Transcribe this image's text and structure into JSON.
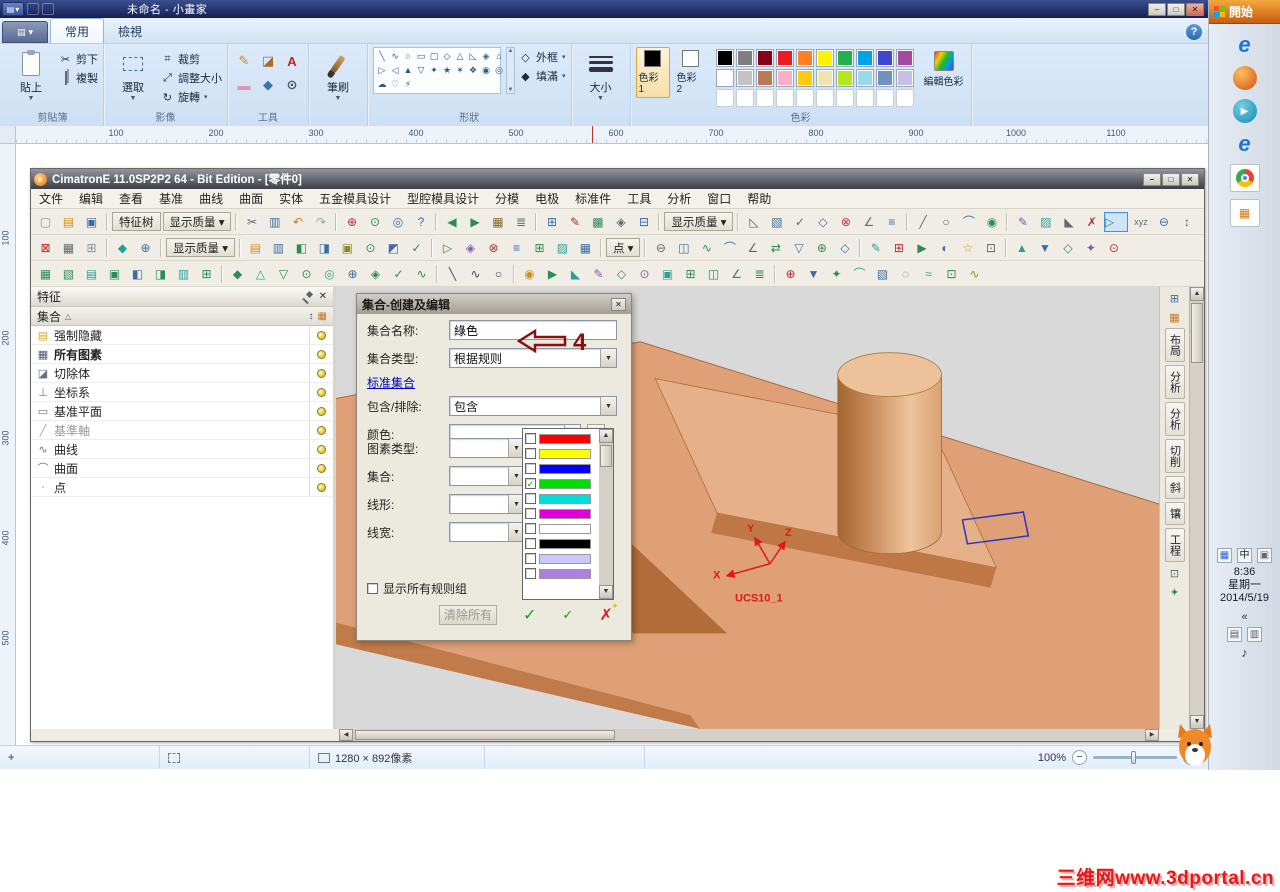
{
  "paint": {
    "title": "未命名 - 小畫家",
    "window_controls": {
      "minimize": "–",
      "maximize": "□",
      "close": "✕"
    },
    "tabs": [
      {
        "label": "常用",
        "active": true
      },
      {
        "label": "檢視",
        "active": false
      }
    ],
    "help_glyph": "?",
    "clipboard": {
      "label": "剪貼簿",
      "paste": "貼上",
      "cut": "剪下",
      "copy": "複製"
    },
    "image": {
      "label": "影像",
      "select": "選取",
      "crop": "裁剪",
      "resize": "調整大小",
      "rotate": "旋轉"
    },
    "tools": {
      "label": "工具",
      "items": [
        {
          "g": "✎",
          "c": "#c89018"
        },
        {
          "g": "◪",
          "c": "#b06828"
        },
        {
          "g": "A",
          "c": "#cc2020"
        },
        {
          "g": "▬",
          "c": "#e890b0"
        },
        {
          "g": "◆",
          "c": "#3878a8"
        },
        {
          "g": "⊙",
          "c": "#485868"
        }
      ]
    },
    "brushes": {
      "label": "筆刷"
    },
    "shapes": {
      "label": "形狀",
      "outline": "外框",
      "fill": "填滿",
      "glyphs": [
        "╲",
        "∿",
        "○",
        "▭",
        "▢",
        "◇",
        "△",
        "◺",
        "◈",
        "⌂",
        "▷",
        "◁",
        "▲",
        "▽",
        "✦",
        "★",
        "✶",
        "❖",
        "◉",
        "◎",
        "☁",
        "♡",
        "⚡"
      ]
    },
    "size": {
      "label": "大小"
    },
    "colors": {
      "label": "色彩",
      "color1_label": "色彩 1",
      "color2_label": "色彩 2",
      "edit_label": "編輯色彩",
      "color1": "#000000",
      "color2": "#ffffff",
      "row1": [
        "#000000",
        "#7f7f7f",
        "#880015",
        "#ed1c24",
        "#ff7f27",
        "#fff200",
        "#22b14c",
        "#00a2e8",
        "#3f48cc",
        "#a349a4"
      ],
      "row2": [
        "#ffffff",
        "#c3c3c3",
        "#b97a57",
        "#ffaec9",
        "#ffc90e",
        "#efe4b0",
        "#b5e61d",
        "#99d9ea",
        "#7092be",
        "#c8bfe7"
      ],
      "row3_count": 10
    },
    "ruler_h": [
      "100",
      "200",
      "300",
      "400",
      "500",
      "600",
      "700",
      "800",
      "900",
      "1000",
      "1100"
    ],
    "ruler_v": [
      "100",
      "200",
      "300",
      "400",
      "500"
    ],
    "status": {
      "size_text": "1280 × 892像素",
      "zoom": "100%"
    }
  },
  "cimatron": {
    "title": "CimatronE 11.0SP2P2 64 - Bit Edition - [零件0]",
    "window_controls": {
      "minimize": "–",
      "maximize": "□",
      "close": "✕"
    },
    "menu": [
      "文件",
      "编辑",
      "查看",
      "基准",
      "曲线",
      "曲面",
      "实体",
      "五金模具设计",
      "型腔模具设计",
      "分模",
      "电极",
      "标准件",
      "工具",
      "分析",
      "窗口",
      "帮助"
    ],
    "toolbar1": [
      {
        "g": "▢",
        "c": "#8890a0"
      },
      {
        "g": "▤",
        "c": "#d09018"
      },
      {
        "g": "▣",
        "c": "#3a6ea5"
      },
      {
        "sep": 1
      },
      {
        "t": "特征树"
      },
      {
        "t": "显示质量 ▾"
      },
      {
        "sep": 1
      },
      {
        "g": "✂",
        "c": "#606870"
      },
      {
        "g": "▥",
        "c": "#3a6ea5"
      },
      {
        "g": "↶",
        "c": "#d07818"
      },
      {
        "g": "↷",
        "c": "#98a0a8"
      },
      {
        "sep": 1
      },
      {
        "g": "⊕",
        "c": "#b03030"
      },
      {
        "g": "⊙",
        "c": "#2e8b57"
      },
      {
        "g": "◎",
        "c": "#3a6ea5"
      },
      {
        "g": "?",
        "c": "#3a6ea5"
      },
      {
        "sep": 1
      },
      {
        "g": "◀",
        "c": "#2e8b57"
      },
      {
        "g": "▶",
        "c": "#2e8b57"
      },
      {
        "g": "▦",
        "c": "#8a6a2a"
      },
      {
        "g": "≣",
        "c": "#606870"
      },
      {
        "sep": 1
      },
      {
        "g": "⊞",
        "c": "#3a6ea5"
      },
      {
        "g": "✎",
        "c": "#b03030"
      },
      {
        "g": "▩",
        "c": "#2e8b57"
      },
      {
        "g": "◈",
        "c": "#606870"
      },
      {
        "g": "⊟",
        "c": "#3a6ea5"
      },
      {
        "sep": 1
      },
      {
        "t": "显示质量 ▾"
      },
      {
        "sep": 1
      },
      {
        "g": "◺",
        "c": "#606870"
      },
      {
        "g": "▧",
        "c": "#3a6ea5"
      },
      {
        "g": "✓",
        "c": "#2e8b57"
      },
      {
        "g": "◇",
        "c": "#3a6ea5"
      },
      {
        "g": "⊗",
        "c": "#b03030"
      },
      {
        "g": "∠",
        "c": "#606870"
      },
      {
        "g": "≡",
        "c": "#3a6ea5"
      },
      {
        "sep": 1
      },
      {
        "g": "╱",
        "c": "#606870"
      },
      {
        "g": "○",
        "c": "#606870"
      },
      {
        "g": "⌒",
        "c": "#3a6ea5"
      },
      {
        "g": "◉",
        "c": "#2e8b57"
      },
      {
        "sep": 1
      },
      {
        "g": "✎",
        "c": "#8858a8"
      },
      {
        "g": "▨",
        "c": "#2aa198"
      },
      {
        "g": "◣",
        "c": "#606870"
      },
      {
        "g": "✗",
        "c": "#b03030"
      },
      {
        "g": "▷",
        "c": "#2e8b57",
        "sel": 1
      },
      {
        "g": "xyz",
        "c": "#606870"
      },
      {
        "g": "⊖",
        "c": "#3a6ea5"
      },
      {
        "g": "↕",
        "c": "#2e8b57"
      }
    ],
    "toolbar2": [
      {
        "g": "⊠",
        "c": "#c82020"
      },
      {
        "g": "▦",
        "c": "#606870"
      },
      {
        "g": "⊞",
        "c": "#8890a0"
      },
      {
        "sep": 1
      },
      {
        "g": "◆",
        "c": "#2aa198"
      },
      {
        "g": "⊕",
        "c": "#3a6ea5"
      },
      {
        "sep": 1
      },
      {
        "t": "显示质量 ▾"
      },
      {
        "sep": 1
      },
      {
        "g": "▤",
        "c": "#d09018"
      },
      {
        "g": "▥",
        "c": "#3a6ea5"
      },
      {
        "g": "◧",
        "c": "#2e8b57"
      },
      {
        "g": "◨",
        "c": "#3a6ea5"
      },
      {
        "g": "▣",
        "c": "#8a8a2a"
      },
      {
        "g": "⊙",
        "c": "#2e8b57"
      },
      {
        "g": "◩",
        "c": "#3a6ea5"
      },
      {
        "g": "✓",
        "c": "#2e8b57"
      },
      {
        "sep": 1
      },
      {
        "g": "▷",
        "c": "#2e8b57"
      },
      {
        "g": "◈",
        "c": "#8858a8"
      },
      {
        "g": "⊗",
        "c": "#b03030"
      },
      {
        "g": "≡",
        "c": "#3a6ea5"
      },
      {
        "g": "⊞",
        "c": "#2e8b57"
      },
      {
        "g": "▨",
        "c": "#2aa198"
      },
      {
        "g": "▦",
        "c": "#3a6ea5"
      },
      {
        "sep": 1
      },
      {
        "t": "点 ▾"
      },
      {
        "sep": 1
      },
      {
        "g": "⊖",
        "c": "#606870"
      },
      {
        "g": "◫",
        "c": "#3a6ea5"
      },
      {
        "g": "∿",
        "c": "#2e8b57"
      },
      {
        "g": "⌒",
        "c": "#3a6ea5"
      },
      {
        "g": "∠",
        "c": "#606870"
      },
      {
        "g": "⇄",
        "c": "#2e8b57"
      },
      {
        "g": "▽",
        "c": "#3a6ea5"
      },
      {
        "g": "⊕",
        "c": "#2e8b57"
      },
      {
        "g": "◇",
        "c": "#3a6ea5"
      },
      {
        "sep": 1
      },
      {
        "g": "✎",
        "c": "#2aa198"
      },
      {
        "g": "⊞",
        "c": "#b03030"
      },
      {
        "g": "▶",
        "c": "#2e8b57"
      },
      {
        "g": "◐",
        "c": "#3a6ea5"
      },
      {
        "g": "☆",
        "c": "#d09018"
      },
      {
        "g": "⊡",
        "c": "#606870"
      },
      {
        "sep": 1
      },
      {
        "g": "▲",
        "c": "#2aa198"
      },
      {
        "g": "▼",
        "c": "#3a6ea5"
      },
      {
        "g": "◇",
        "c": "#2e8b57"
      },
      {
        "g": "✦",
        "c": "#8858a8"
      },
      {
        "g": "⊙",
        "c": "#b03030"
      }
    ],
    "toolbar3": [
      {
        "g": "▦",
        "c": "#2e8b57"
      },
      {
        "g": "▧",
        "c": "#2e8b57"
      },
      {
        "g": "▤",
        "c": "#2aa198"
      },
      {
        "g": "▣",
        "c": "#2e8b57"
      },
      {
        "g": "◧",
        "c": "#3a6ea5"
      },
      {
        "g": "◨",
        "c": "#2e8b57"
      },
      {
        "g": "▥",
        "c": "#2aa198"
      },
      {
        "g": "⊞",
        "c": "#2e8b57"
      },
      {
        "sep": 1
      },
      {
        "g": "◆",
        "c": "#2e8b57"
      },
      {
        "g": "△",
        "c": "#2aa198"
      },
      {
        "g": "▽",
        "c": "#2e8b57"
      },
      {
        "g": "⊙",
        "c": "#2e8b57"
      },
      {
        "g": "◎",
        "c": "#2aa198"
      },
      {
        "g": "⊕",
        "c": "#3a6ea5"
      },
      {
        "g": "◈",
        "c": "#2e8b57"
      },
      {
        "g": "✓",
        "c": "#2e8b57"
      },
      {
        "g": "∿",
        "c": "#2e8b57"
      },
      {
        "sep": 1
      },
      {
        "g": "╲",
        "c": "#404850"
      },
      {
        "g": "∿",
        "c": "#404850"
      },
      {
        "g": "○",
        "c": "#404850"
      },
      {
        "sep": 1
      },
      {
        "g": "◉",
        "c": "#d09018"
      },
      {
        "g": "▶",
        "c": "#2e8b57"
      },
      {
        "g": "◣",
        "c": "#2aa198"
      },
      {
        "g": "✎",
        "c": "#8858a8"
      },
      {
        "g": "◇",
        "c": "#2e8b57"
      },
      {
        "g": "⊙",
        "c": "#8858a8"
      },
      {
        "g": "▣",
        "c": "#2aa198"
      },
      {
        "g": "⊞",
        "c": "#2e8b57"
      },
      {
        "g": "◫",
        "c": "#2e8b57"
      },
      {
        "g": "∠",
        "c": "#2e8b57"
      },
      {
        "g": "≣",
        "c": "#2e8b57"
      },
      {
        "sep": 1
      },
      {
        "g": "⊕",
        "c": "#b03030"
      },
      {
        "g": "▼",
        "c": "#3a6ea5"
      },
      {
        "g": "✦",
        "c": "#2e8b57"
      },
      {
        "g": "⌒",
        "c": "#2aa198"
      },
      {
        "g": "▧",
        "c": "#3a6ea5"
      },
      {
        "g": "◌",
        "c": "#2e8b57"
      },
      {
        "g": "≈",
        "c": "#2aa198"
      },
      {
        "g": "⊡",
        "c": "#2e8b57"
      },
      {
        "g": "∿",
        "c": "#7a9a2a"
      }
    ],
    "features": {
      "title": "特征",
      "column_header": "集合",
      "items": [
        {
          "icon": "▤",
          "ic": "#d9a520",
          "label": "强制隐藏"
        },
        {
          "icon": "▦",
          "ic": "#4a5a78",
          "label": "所有图素",
          "bold": true
        },
        {
          "icon": "◪",
          "ic": "#6a7280",
          "label": "切除体"
        },
        {
          "icon": "⊥",
          "ic": "#6a7280",
          "label": "坐标系"
        },
        {
          "icon": "▭",
          "ic": "#6a7280",
          "label": "基准平面"
        },
        {
          "icon": "╱",
          "ic": "#9aa0a8",
          "label": "基準軸",
          "gray": true
        },
        {
          "icon": "∿",
          "ic": "#6a7280",
          "label": "曲线"
        },
        {
          "icon": "⌒",
          "ic": "#6a7280",
          "label": "曲面"
        },
        {
          "icon": "∙",
          "ic": "#6a7280",
          "label": "点"
        }
      ]
    },
    "dialog": {
      "title": "集合-创建及编辑",
      "close_glyph": "✕",
      "name_label": "集合名称:",
      "name_value": "綠色",
      "type_label": "集合类型:",
      "type_value": "根据规则",
      "annotation_number": "4",
      "standard_link": "标准集合",
      "include_label": "包含/排除:",
      "include_value": "包含",
      "color_label": "颜色:",
      "more_glyph": "...",
      "rows": [
        {
          "label": "图素类型:"
        },
        {
          "label": "集合:"
        },
        {
          "label": "线形:"
        },
        {
          "label": "线宽:"
        }
      ],
      "color_list": [
        {
          "hex": "#ff0000",
          "checked": false
        },
        {
          "hex": "#ffff00",
          "checked": false
        },
        {
          "hex": "#0000ff",
          "checked": false
        },
        {
          "hex": "#00dd00",
          "checked": true
        },
        {
          "hex": "#00dddd",
          "checked": false
        },
        {
          "hex": "#dd00dd",
          "checked": false
        },
        {
          "hex": "#ffffff",
          "checked": false
        },
        {
          "hex": "#000000",
          "checked": false
        },
        {
          "hex": "#c8c8ff",
          "checked": false
        },
        {
          "hex": "#b080e0",
          "checked": false
        }
      ],
      "show_all_label": "显示所有规则组",
      "clear_all_label": "清除所有",
      "ok_glyph": "✓",
      "apply_glyph": "✓",
      "cancel_glyph": "✗"
    },
    "viewport": {
      "ucs_label": "UCS10_1",
      "axes": {
        "x": "X",
        "y": "Y",
        "z": "Z"
      }
    },
    "right_panel": {
      "icons_top": [
        {
          "g": "⊞",
          "c": "#3a6ea5"
        },
        {
          "g": "▦",
          "c": "#c87828"
        }
      ],
      "tabs": [
        "布局",
        "分析",
        "分析",
        "切削",
        "斜",
        "镶",
        "工程"
      ],
      "icons_bottom": [
        {
          "g": "⊡",
          "c": "#606870"
        },
        {
          "g": "✦",
          "c": "#2e8b57"
        }
      ]
    }
  },
  "taskbar": {
    "start_label": "開始",
    "app_icons": [
      {
        "kind": "ie"
      },
      {
        "kind": "ball"
      },
      {
        "kind": "teal"
      },
      {
        "kind": "ie"
      },
      {
        "kind": "chrome"
      },
      {
        "kind": "appbox"
      }
    ],
    "tray_icons": [
      {
        "g": "▦",
        "c": "#2a66c8"
      },
      {
        "g": "中",
        "c": "#222"
      },
      {
        "g": "▣",
        "c": "#667"
      }
    ],
    "clock": {
      "time": "8:36",
      "day": "星期一",
      "date": "2014/5/19"
    },
    "collapse_glyph": "«",
    "tray2_icons": [
      {
        "g": "▤",
        "c": "#556"
      },
      {
        "g": "▥",
        "c": "#556"
      }
    ],
    "speaker_glyph": "♪"
  },
  "watermark": "三维网www.3dportal.cn"
}
